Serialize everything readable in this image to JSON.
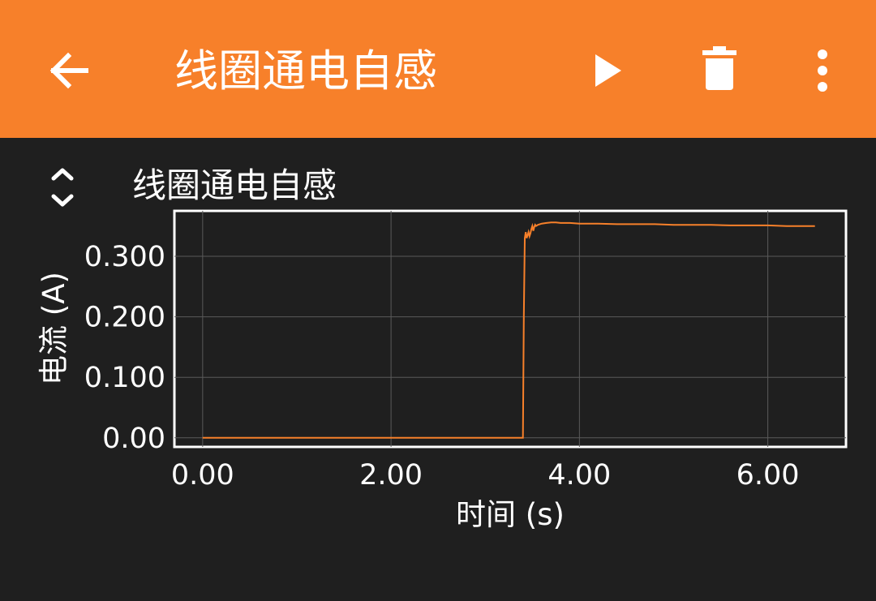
{
  "app_bar": {
    "title": "线圈通电自感",
    "background": "#f7802a",
    "icons": {
      "back": "arrow-back-icon",
      "play": "play-icon",
      "delete": "trash-icon",
      "more": "more-vertical-icon"
    }
  },
  "graph": {
    "title": "线圈通电自感",
    "toggle_icon": "expand-collapse-icon"
  },
  "chart_data": {
    "type": "line",
    "title": "线圈通电自感",
    "xlabel": "时间 (s)",
    "ylabel": "电流 (A)",
    "xlim": [
      -0.3,
      6.83
    ],
    "ylim": [
      -0.015,
      0.375
    ],
    "xticks": [
      0,
      2,
      4,
      6
    ],
    "xtick_labels": [
      "0.00",
      "2.00",
      "4.00",
      "6.00"
    ],
    "yticks": [
      0,
      0.1,
      0.2,
      0.3
    ],
    "ytick_labels": [
      "0.00",
      "0.100",
      "0.200",
      "0.300"
    ],
    "grid": true,
    "line_color": "#f7802a",
    "series": [
      {
        "x": [
          0.0,
          0.5,
          1.0,
          1.5,
          2.0,
          2.5,
          3.0,
          3.4,
          3.41,
          3.42,
          3.43,
          3.44,
          3.45,
          3.46,
          3.47,
          3.48,
          3.49,
          3.5,
          3.51,
          3.52,
          3.53,
          3.54,
          3.56,
          3.58,
          3.6,
          3.65,
          3.7,
          3.75,
          3.8,
          3.9,
          4.0,
          4.2,
          4.4,
          4.6,
          4.8,
          5.0,
          5.2,
          5.4,
          5.6,
          5.8,
          6.0,
          6.2,
          6.4,
          6.5
        ],
        "y": [
          0.0,
          0.0,
          0.0,
          0.0,
          0.0,
          0.0,
          0.0,
          0.0,
          0.2,
          0.33,
          0.34,
          0.33,
          0.335,
          0.34,
          0.333,
          0.338,
          0.345,
          0.35,
          0.342,
          0.348,
          0.352,
          0.35,
          0.352,
          0.353,
          0.354,
          0.355,
          0.356,
          0.356,
          0.355,
          0.355,
          0.354,
          0.354,
          0.353,
          0.353,
          0.353,
          0.352,
          0.352,
          0.352,
          0.351,
          0.351,
          0.351,
          0.35,
          0.35,
          0.35
        ]
      }
    ]
  }
}
